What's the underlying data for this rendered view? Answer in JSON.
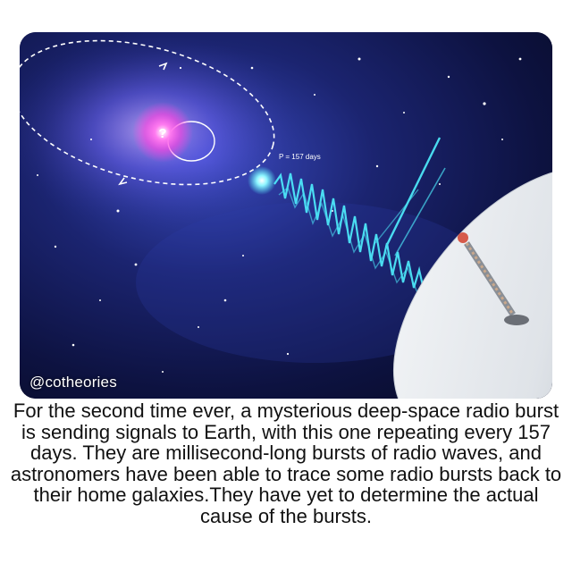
{
  "image": {
    "period_label": "P = 157 days",
    "mystery_mark": "?",
    "handle": "@cotheories",
    "colors": {
      "space": "#0b0f2e",
      "nebula": "#3a4bc2",
      "source_glow": "#ff3de0",
      "signal": "#4ff0ff",
      "dish": "#e9ecef"
    }
  },
  "caption": {
    "text": "For the second time ever, a mysterious deep-space radio burst is sending signals to Earth, with this one repeating every 157 days. They are millisecond-long bursts of radio waves, and astronomers have been able to trace some radio bursts back to their home galaxies.They have yet to determine the actual cause of the bursts."
  }
}
